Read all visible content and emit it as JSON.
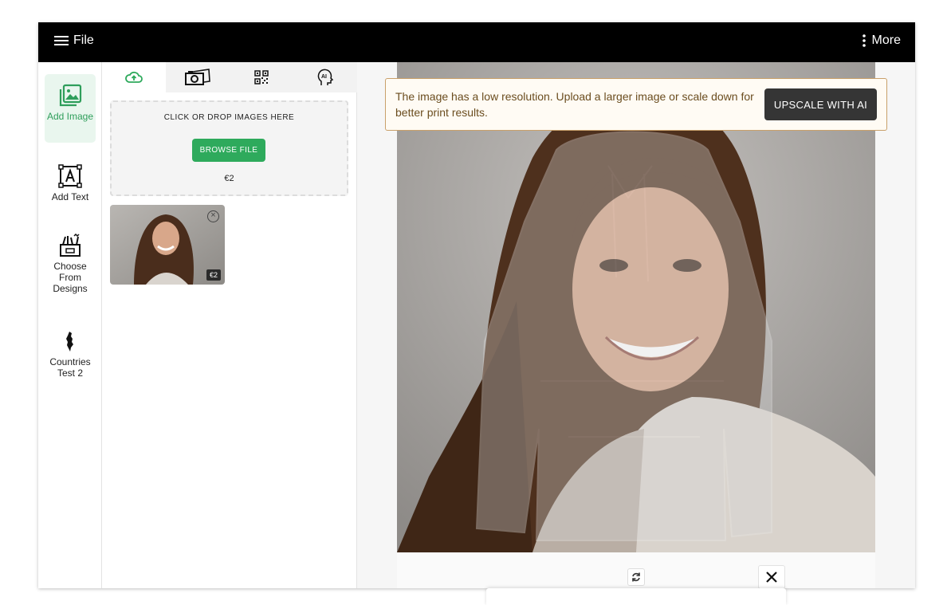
{
  "topbar": {
    "file_label": "File",
    "more_label": "More"
  },
  "left_rail": {
    "items": [
      {
        "label": "Add Image",
        "icon": "image-gallery-icon",
        "active": true
      },
      {
        "label": "Add Text",
        "icon": "text-box-icon",
        "active": false
      },
      {
        "label": "Choose From Designs",
        "icon": "design-basket-icon",
        "active": false
      },
      {
        "label": "Countries Test 2",
        "icon": "country-map-icon",
        "active": false
      }
    ]
  },
  "panel": {
    "tabs": [
      {
        "icon": "cloud-upload-icon",
        "active": true
      },
      {
        "icon": "camera-photos-icon",
        "active": false
      },
      {
        "icon": "qr-code-icon",
        "active": false
      },
      {
        "icon": "ai-head-icon",
        "active": false
      }
    ],
    "dropzone": {
      "title": "CLICK OR DROP IMAGES HERE",
      "browse_label": "BROWSE FILE",
      "price": "€2"
    },
    "uploaded": [
      {
        "price": "€2",
        "remove_icon": "remove-circle-icon"
      }
    ]
  },
  "canvas": {
    "warning_text": "The image has a low resolution. Upload a larger image or scale down for better print results.",
    "upscale_label": "UPSCALE WITH AI",
    "rotate_icon": "rotate-icon",
    "close_icon": "close-icon"
  },
  "colors": {
    "accent": "#2eaa5c",
    "topbar": "#000000",
    "warning_border": "#c9a06a",
    "warning_bg": "#fffbf4"
  }
}
